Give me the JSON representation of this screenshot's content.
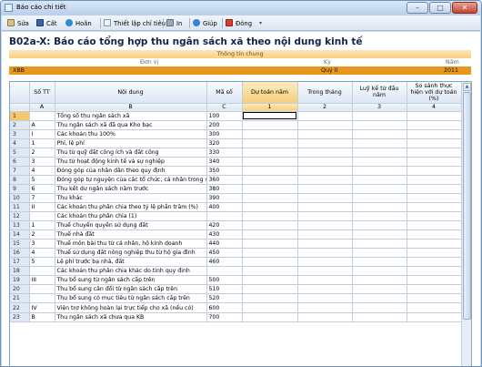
{
  "window": {
    "title": "Báo cáo chi tiết"
  },
  "toolbar": {
    "items": [
      {
        "label": "Sửa",
        "icon": "edit-icon"
      },
      {
        "label": "Cất",
        "icon": "save-icon"
      },
      {
        "label": "Hoãn",
        "icon": "undo-icon"
      },
      {
        "label": "Thiết lập chỉ tiêu",
        "icon": "settings-list-icon"
      },
      {
        "label": "In",
        "icon": "print-icon"
      },
      {
        "label": "Giúp",
        "icon": "help-icon"
      },
      {
        "label": "Đóng",
        "icon": "close-icon"
      }
    ]
  },
  "report": {
    "title": "B02a-X: Báo cáo tổng hợp thu ngân sách xã theo nội dung kinh tế"
  },
  "info": {
    "section": "Thông tin chung",
    "labels": {
      "unit": "Đơn vị",
      "period": "Kỳ",
      "year": "Năm"
    },
    "values": {
      "unit": "XBB",
      "period": "Quý II",
      "year": "2011"
    }
  },
  "grid": {
    "headers": [
      "Số TT",
      "Nội dung",
      "Mã số",
      "Dự toán năm",
      "Trong tháng",
      "Luỹ kế từ đầu năm",
      "So sánh thực hiện với dự toán (%)"
    ],
    "subheaders": [
      "A",
      "B",
      "C",
      "1",
      "2",
      "3",
      "4"
    ],
    "rows": [
      {
        "n": "1",
        "stt": "",
        "content": "Tổng số thu ngân sách xã",
        "code": "100"
      },
      {
        "n": "2",
        "stt": "A",
        "content": "Thu ngân sách xã đã qua Kho bạc",
        "code": "200"
      },
      {
        "n": "3",
        "stt": "I",
        "content": "Các khoản thu 100%",
        "code": "300"
      },
      {
        "n": "4",
        "stt": "1",
        "content": "Phí, lệ phí",
        "code": "320"
      },
      {
        "n": "5",
        "stt": "2",
        "content": "Thu từ quỹ đất công ích và đất công",
        "code": "330"
      },
      {
        "n": "6",
        "stt": "3",
        "content": "Thu từ hoạt động kinh tế và sự nghiệp",
        "code": "340"
      },
      {
        "n": "7",
        "stt": "4",
        "content": "Đóng góp của nhân dân theo quy định",
        "code": "350"
      },
      {
        "n": "8",
        "stt": "5",
        "content": "Đóng góp tự nguyện của các tổ chức, cá nhân trong và ngoài nước",
        "code": "360"
      },
      {
        "n": "9",
        "stt": "6",
        "content": "Thu kết dư ngân sách năm trước",
        "code": "380"
      },
      {
        "n": "10",
        "stt": "7",
        "content": "Thu khác",
        "code": "390"
      },
      {
        "n": "11",
        "stt": "II",
        "content": "Các khoản thu phân chia theo tỷ lệ phần trăm (%)",
        "code": "400"
      },
      {
        "n": "12",
        "stt": "",
        "content": "Các khoản thu phân chia (1)",
        "code": ""
      },
      {
        "n": "13",
        "stt": "1",
        "content": "Thuế chuyển quyền sử dụng đất",
        "code": "420"
      },
      {
        "n": "14",
        "stt": "2",
        "content": "Thuế nhà đất",
        "code": "430"
      },
      {
        "n": "15",
        "stt": "3",
        "content": "Thuế môn bài thu từ cá nhân, hộ kinh doanh",
        "code": "440"
      },
      {
        "n": "16",
        "stt": "4",
        "content": "Thuế sử dụng đất nông nghiệp thu từ hộ gia đình",
        "code": "450"
      },
      {
        "n": "17",
        "stt": "5",
        "content": "Lệ phí trước bạ nhà, đất",
        "code": "460"
      },
      {
        "n": "18",
        "stt": "",
        "content": "Các khoản thu phân chia khác do tỉnh quy định",
        "code": ""
      },
      {
        "n": "19",
        "stt": "III",
        "content": "Thu bổ sung từ ngân sách cấp trên",
        "code": "500"
      },
      {
        "n": "20",
        "stt": "",
        "content": "Thu bổ sung cân đối từ ngân sách cấp trên",
        "code": "510"
      },
      {
        "n": "21",
        "stt": "",
        "content": "Thu bổ sung có mục tiêu từ ngân sách cấp trên",
        "code": "520"
      },
      {
        "n": "22",
        "stt": "IV",
        "content": "Viện trợ không hoàn lại trực tiếp cho xã (nếu có)",
        "code": "600"
      },
      {
        "n": "23",
        "stt": "B",
        "content": "Thu ngân sách xã chưa qua KB",
        "code": "700"
      }
    ]
  },
  "colors": {
    "accent": "#e9961e",
    "header": "#f8cf7e",
    "window": "#c9dbef"
  }
}
